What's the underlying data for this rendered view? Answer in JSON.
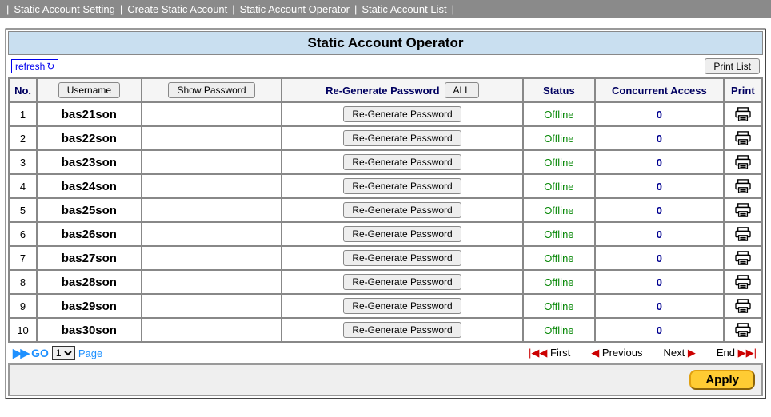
{
  "nav": {
    "items": [
      "Static Account Setting",
      "Create Static Account",
      "Static Account Operator",
      "Static Account List"
    ]
  },
  "page": {
    "title": "Static Account Operator",
    "refresh": "refresh",
    "print_list": "Print List"
  },
  "table": {
    "headers": {
      "no": "No.",
      "username": "Username",
      "show_password": "Show Password",
      "regen": "Re-Generate Password",
      "all": "ALL",
      "status": "Status",
      "concurrent": "Concurrent Access",
      "print": "Print"
    },
    "regen_btn": "Re-Generate Password",
    "rows": [
      {
        "no": 1,
        "username": "bas21son",
        "password": "",
        "status": "Offline",
        "concurrent": 0
      },
      {
        "no": 2,
        "username": "bas22son",
        "password": "",
        "status": "Offline",
        "concurrent": 0
      },
      {
        "no": 3,
        "username": "bas23son",
        "password": "",
        "status": "Offline",
        "concurrent": 0
      },
      {
        "no": 4,
        "username": "bas24son",
        "password": "",
        "status": "Offline",
        "concurrent": 0
      },
      {
        "no": 5,
        "username": "bas25son",
        "password": "",
        "status": "Offline",
        "concurrent": 0
      },
      {
        "no": 6,
        "username": "bas26son",
        "password": "",
        "status": "Offline",
        "concurrent": 0
      },
      {
        "no": 7,
        "username": "bas27son",
        "password": "",
        "status": "Offline",
        "concurrent": 0
      },
      {
        "no": 8,
        "username": "bas28son",
        "password": "",
        "status": "Offline",
        "concurrent": 0
      },
      {
        "no": 9,
        "username": "bas29son",
        "password": "",
        "status": "Offline",
        "concurrent": 0
      },
      {
        "no": 10,
        "username": "bas30son",
        "password": "",
        "status": "Offline",
        "concurrent": 0
      }
    ]
  },
  "pager": {
    "go": "GO",
    "page_select": "1",
    "page_label": "Page",
    "first": "First",
    "previous": "Previous",
    "next": "Next",
    "end": "End"
  },
  "footer": {
    "apply": "Apply"
  },
  "chart_data": {
    "type": "table",
    "columns": [
      "No.",
      "Username",
      "Show Password",
      "Re-Generate Password",
      "Status",
      "Concurrent Access",
      "Print"
    ],
    "rows": [
      [
        1,
        "bas21son",
        "",
        "Re-Generate Password",
        "Offline",
        0,
        ""
      ],
      [
        2,
        "bas22son",
        "",
        "Re-Generate Password",
        "Offline",
        0,
        ""
      ],
      [
        3,
        "bas23son",
        "",
        "Re-Generate Password",
        "Offline",
        0,
        ""
      ],
      [
        4,
        "bas24son",
        "",
        "Re-Generate Password",
        "Offline",
        0,
        ""
      ],
      [
        5,
        "bas25son",
        "",
        "Re-Generate Password",
        "Offline",
        0,
        ""
      ],
      [
        6,
        "bas26son",
        "",
        "Re-Generate Password",
        "Offline",
        0,
        ""
      ],
      [
        7,
        "bas27son",
        "",
        "Re-Generate Password",
        "Offline",
        0,
        ""
      ],
      [
        8,
        "bas28son",
        "",
        "Re-Generate Password",
        "Offline",
        0,
        ""
      ],
      [
        9,
        "bas29son",
        "",
        "Re-Generate Password",
        "Offline",
        0,
        ""
      ],
      [
        10,
        "bas30son",
        "",
        "Re-Generate Password",
        "Offline",
        0,
        ""
      ]
    ]
  }
}
